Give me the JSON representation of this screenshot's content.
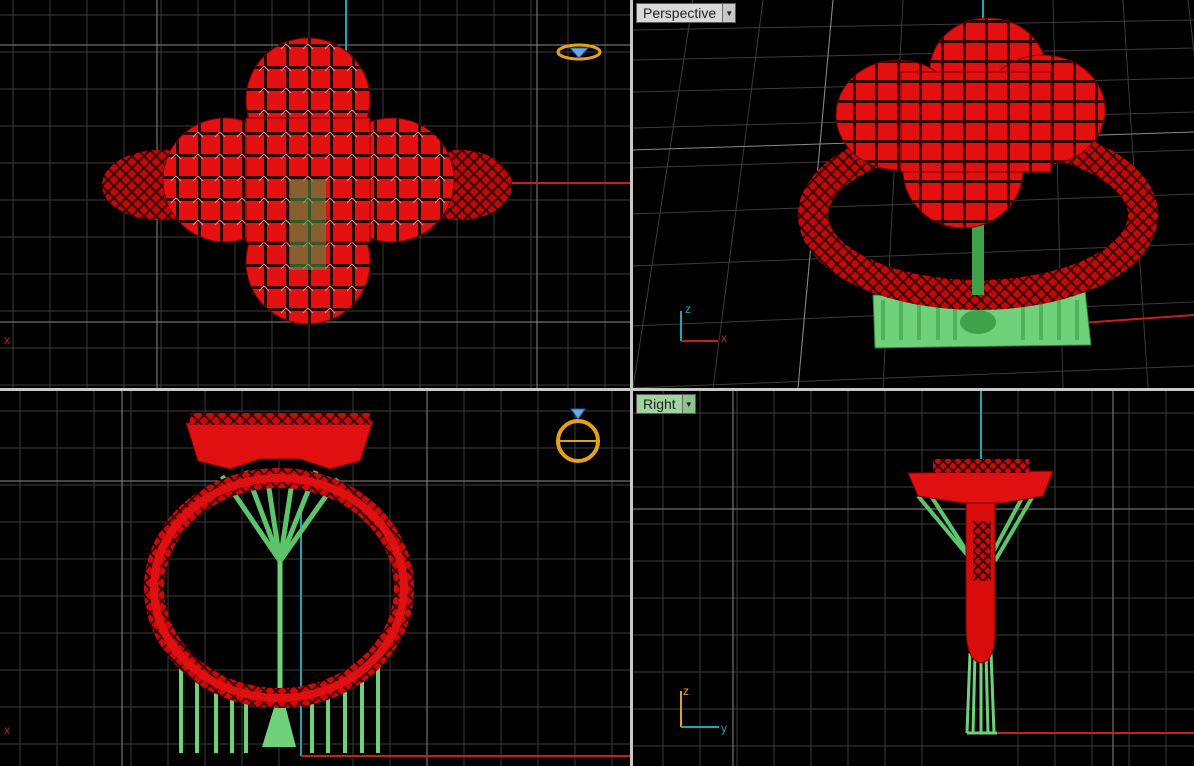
{
  "viewports": {
    "top": {
      "label": "",
      "x_marker": "x"
    },
    "perspective": {
      "label": "Perspective",
      "triad": {
        "x": "x",
        "z": "z"
      }
    },
    "front": {
      "label": "",
      "x_marker": "x"
    },
    "right": {
      "label": "Right",
      "triad": {
        "z": "z",
        "y": "y"
      }
    }
  },
  "colors": {
    "background": "#000000",
    "grid_minor": "#3c3c3c",
    "grid_major": "#8a8a8a",
    "axis_x": "#c81e1e",
    "axis_y": "#1aa9b0",
    "model_red": "#dd0b0b",
    "support_green": "#6fd27a",
    "view_icon": "#e3a21a"
  },
  "icons": {
    "dropdown": "chevron-down-icon",
    "view_cube": "ring-view-icon"
  }
}
